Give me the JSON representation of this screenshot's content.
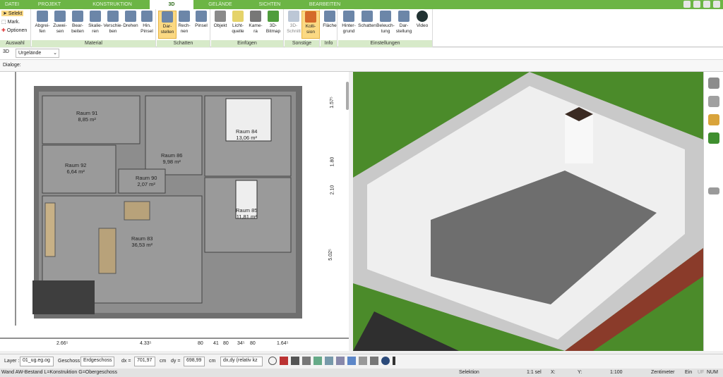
{
  "tabs": [
    "DATEI",
    "PROJEKT",
    "KONSTRUKTION",
    "3D",
    "GELÄNDE",
    "SICHTEN",
    "BEARBEITEN"
  ],
  "active_tab": "3D",
  "ribbon": {
    "auswahl": {
      "label": "Auswahl",
      "items": [
        "Selekt",
        "Mark.",
        "Optionen"
      ]
    },
    "material": {
      "label": "Material",
      "buttons": [
        "Abgrei-\nfen",
        "Zuwei-\nsen",
        "Bear-\nbeiten",
        "Skalie-\nren",
        "Verschie-\nben",
        "Drehen",
        "Hin.\nPinsel"
      ]
    },
    "schatten": {
      "label": "Schatten",
      "buttons": [
        "Dar-\nstellen",
        "Rech-\nnen",
        "Pinsel"
      ]
    },
    "einfuegen": {
      "label": "Einfügen",
      "buttons": [
        "Objekt",
        "Licht-\nquelle",
        "Kame-\nra",
        "3D-\nBitmap"
      ]
    },
    "sonstige": {
      "label": "Sonstige",
      "buttons": [
        "3D-\nSchnitt",
        "Kolli-\nsion"
      ]
    },
    "info": {
      "label": "Info",
      "buttons": [
        "Fläche"
      ]
    },
    "einstellungen": {
      "label": "Einstellungen",
      "buttons": [
        "Hinter-\ngrund",
        "Schatten",
        "Beleuch-\ntung",
        "Dar-\nstellung",
        "Video"
      ]
    }
  },
  "viewbar": {
    "mode": "3D",
    "terrain": "Urgelände"
  },
  "dialog_label": "Dialoge:",
  "rooms": [
    {
      "name": "Raum 91",
      "area": "8,85 m²"
    },
    {
      "name": "Raum 92",
      "area": "6,64 m²"
    },
    {
      "name": "Raum 86",
      "area": "9,98 m²"
    },
    {
      "name": "Raum 90",
      "area": "2,07 m²"
    },
    {
      "name": "Raum 84",
      "area": "13,06 m²"
    },
    {
      "name": "Raum 85",
      "area": "11,81 m²"
    },
    {
      "name": "Raum 83",
      "area": "36,53 m²"
    }
  ],
  "dims_bottom": [
    "2.66⁵",
    "4.33⁵",
    "80",
    "41",
    "80",
    "34⁵",
    "80",
    "1.64⁵"
  ],
  "dims_right": [
    "1.57⁵",
    "1.80",
    "2.10",
    "5.02⁵"
  ],
  "status": {
    "layer_label": "Layer :",
    "layer_value": "01_ug.eg.og",
    "geschoss_label": "Geschoss :",
    "geschoss_value": "Erdgeschoss",
    "dx_label": "dx =",
    "dx_value": "701,97",
    "dx_unit": "cm",
    "dy_label": "dy =",
    "dy_value": "698,99",
    "dy_unit": "cm",
    "mode": "dx,dy (relativ kz"
  },
  "bottom": {
    "hint": "Wand AW-Bestand L=Konstruktion G=Obergeschoss",
    "mode": "Selektion",
    "scale": "1:1 sel",
    "x": "X:",
    "y": "Y:",
    "ratio": "1:100",
    "unit": "Zentimeter",
    "ein": "Ein",
    "uf": "UF",
    "num": "NUM"
  }
}
